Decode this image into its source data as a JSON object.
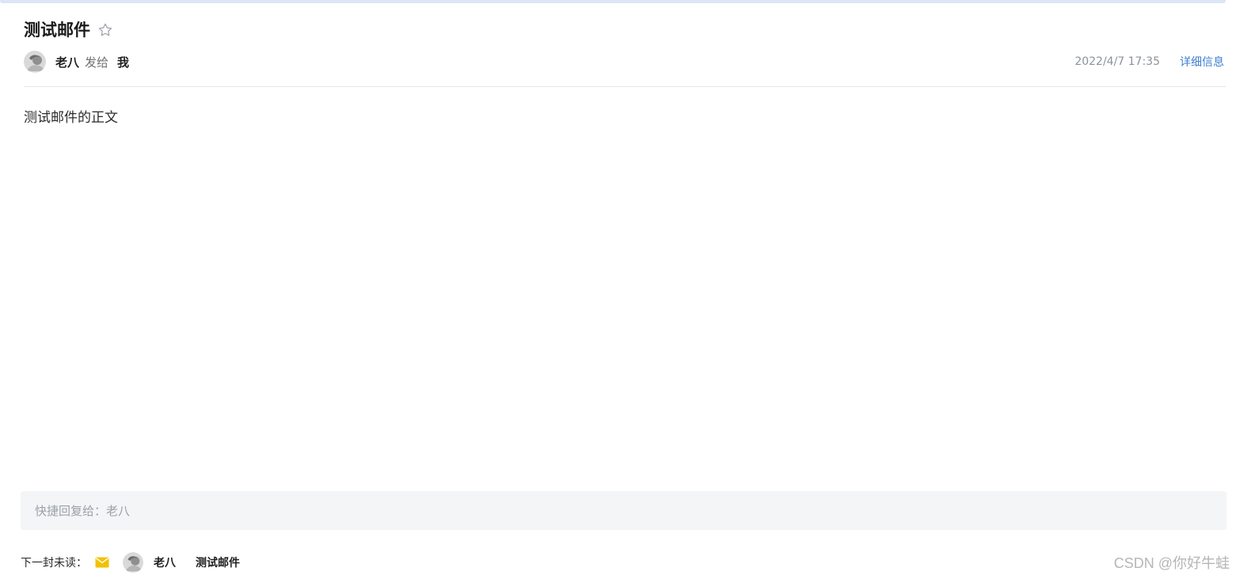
{
  "theme": {
    "accent_bar": "#dbe6f7",
    "link_color": "#3f7fd3",
    "mail_icon_color": "#f2c200",
    "reply_bg": "#f4f5f7"
  },
  "email": {
    "subject": "测试邮件",
    "star_icon": "star-outline-icon",
    "sender_name": "老八",
    "sent_to_label": "发给",
    "recipient_name": "我",
    "time": "2022/4/7 17:35",
    "details_link": "详细信息",
    "body_text": "测试邮件的正文"
  },
  "quick_reply": {
    "placeholder": "快捷回复给：老八"
  },
  "next_unread": {
    "label": "下一封未读：",
    "icon": "mail-icon",
    "sender_name": "老八",
    "subject": "测试邮件"
  },
  "watermark": {
    "text": "CSDN @你好牛蛙"
  }
}
